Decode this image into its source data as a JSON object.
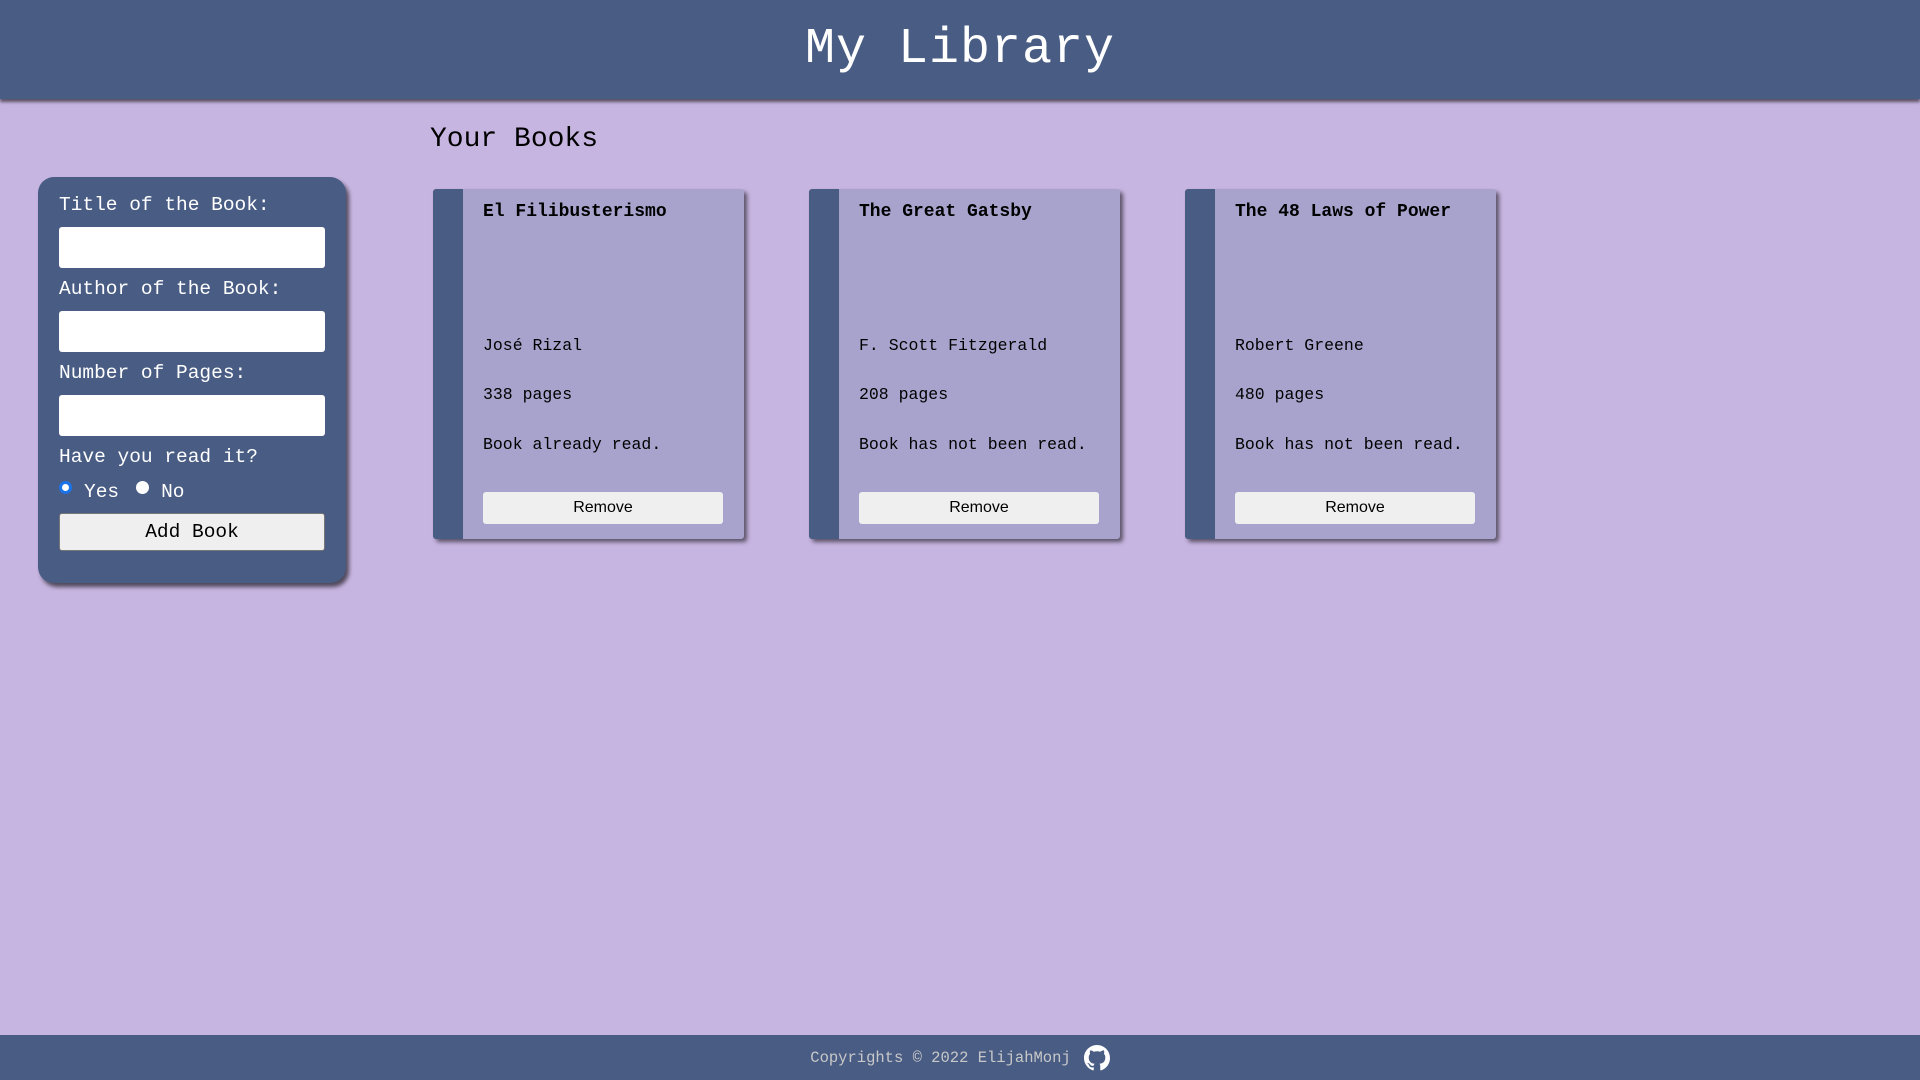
{
  "header": {
    "title": "My Library"
  },
  "main": {
    "section_title": "Your Books"
  },
  "form": {
    "title_label": "Title of the Book:",
    "title_value": "",
    "author_label": "Author of the Book:",
    "author_value": "",
    "pages_label": "Number of Pages:",
    "pages_value": "",
    "read_question": "Have you read it?",
    "read_yes_label": "Yes",
    "read_no_label": "No",
    "read_selected": "Yes",
    "submit_label": "Add Book"
  },
  "books": [
    {
      "title": "El Filibusterismo",
      "author": "José Rizal",
      "pages": "338 pages",
      "status": "Book already read.",
      "remove_label": "Remove"
    },
    {
      "title": "The Great Gatsby",
      "author": "F. Scott Fitzgerald",
      "pages": "208 pages",
      "status": "Book has not been read.",
      "remove_label": "Remove"
    },
    {
      "title": "The 48 Laws of Power",
      "author": "Robert Greene",
      "pages": "480 pages",
      "status": "Book has not been read.",
      "remove_label": "Remove"
    }
  ],
  "footer": {
    "copyright": "Copyrights © 2022 ElijahMonj",
    "icon": "github-icon"
  },
  "colors": {
    "background": "#c7b5e1",
    "accent": "#495c84",
    "card": "#a8a3cc"
  }
}
